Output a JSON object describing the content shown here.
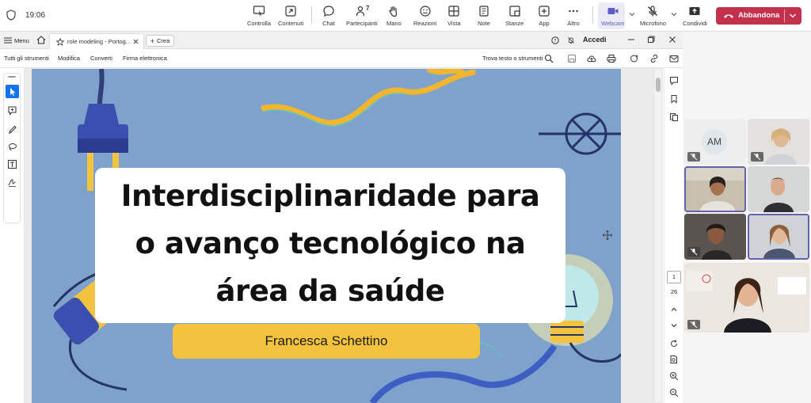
{
  "teams": {
    "time": "19:06",
    "buttons": {
      "controlla": "Controlla",
      "contenuti": "Contenuti",
      "chat": "Chat",
      "partecipanti": "Partecipanti",
      "partecipanti_count": "7",
      "mano": "Mano",
      "reazioni": "Reazioni",
      "vista": "Vista",
      "note": "Note",
      "stanze": "Stanze",
      "app": "App",
      "altro": "Altro",
      "webcam": "Webcam",
      "microfono": "Microfono",
      "condividi": "Condividi",
      "abbandona": "Abbandona"
    },
    "colors": {
      "leave": "#c4314b",
      "accent": "#6264a7"
    }
  },
  "browser": {
    "menu_label": "Menu",
    "tab_title": "role modeling - Portog...",
    "new_tab_label": "Crea",
    "sign_in": "Accedi"
  },
  "acrobat": {
    "toolbar": {
      "all_tools": "Tutti gli strumenti",
      "edit": "Modifica",
      "convert": "Converti",
      "esign": "Firma elettronica",
      "find": "Trova testo o strumenti"
    },
    "page_current": "1",
    "page_total": "26"
  },
  "slide": {
    "title_lines": [
      "Interdisciplinaridade para",
      "o avanço tecnológico na",
      "área da saúde"
    ],
    "author": "Francesca Schettino",
    "colors": {
      "background": "#7fa2cc",
      "card": "#ffffff",
      "author_box": "#f3c23f"
    }
  },
  "participants": {
    "tiles": [
      {
        "initials": "AM",
        "muted": true
      },
      {
        "muted": true
      },
      {
        "muted": false,
        "active": true
      },
      {
        "muted": false
      },
      {
        "muted": true
      },
      {
        "muted": false,
        "active": true
      },
      {
        "muted": true
      }
    ]
  }
}
